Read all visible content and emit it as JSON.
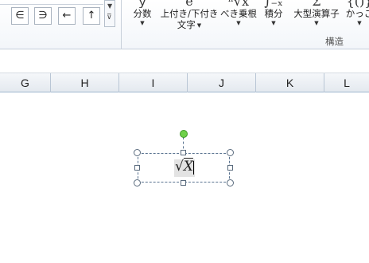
{
  "ribbon": {
    "symbols": [
      "∈",
      "∋",
      "←",
      "↑"
    ],
    "buttons": [
      {
        "id": "fraction",
        "label": "分数",
        "icon": "ｙ"
      },
      {
        "id": "script",
        "label_line1": "上付き/下付き",
        "label_line2": "文字",
        "icon": "e"
      },
      {
        "id": "radical",
        "label": "べき乗根",
        "icon": "ⁿ√x"
      },
      {
        "id": "integral",
        "label": "積分",
        "icon": "∫₋ₓ"
      },
      {
        "id": "large-operator",
        "label": "大型演算子",
        "icon": "Σ"
      },
      {
        "id": "bracket",
        "label": "かっこ",
        "icon": "{()}"
      }
    ],
    "group_label": "構造",
    "dropdown_glyph": "▼"
  },
  "columns": [
    "G",
    "H",
    "I",
    "J",
    "K",
    "L"
  ],
  "equation": {
    "radical": "√",
    "variable": "X"
  }
}
